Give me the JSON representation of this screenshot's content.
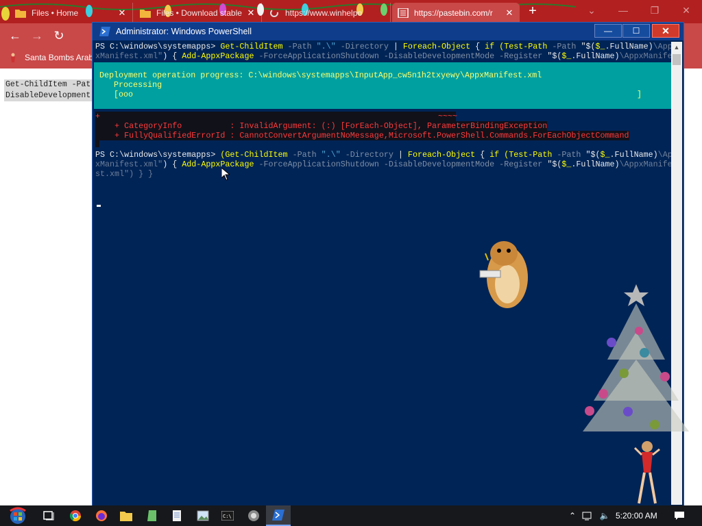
{
  "browser": {
    "tabs": [
      {
        "label": "Files • Home"
      },
      {
        "label": "Files • Download stable"
      },
      {
        "label": "https://www.winhelpo"
      },
      {
        "label": "https://pastebin.com/r"
      }
    ],
    "new_tab_symbol": "+",
    "bookmark": {
      "label": "Santa Bombs Arab"
    },
    "page_snippet": [
      "Get-ChildItem -Pat",
      "DisableDevelopment"
    ],
    "theme_color": "#c94848"
  },
  "powershell": {
    "title": "Administrator: Windows PowerShell",
    "controls": {
      "minimize": "—",
      "maximize": "☐",
      "close": "✕"
    },
    "console": {
      "prompt": "PS C:\\windows\\systemapps>",
      "cmd1_line1": {
        "a": "Get-ChildItem",
        "b": " -Path ",
        "c": "\".\\\"",
        "d": " -Directory ",
        "e": "|",
        "f": " Foreach-Object ",
        "g": "{ ",
        "h": "if",
        "i": " (Test-Path",
        "j": " -Path ",
        "k": "\"$(",
        "l": "$_",
        "m": ".FullName)",
        "n": "\\App"
      },
      "cmd1_line2": {
        "a": "xManifest.xml\"",
        "b": ") { ",
        "c": "Add-AppxPackage",
        "d": " -ForceApplicationShutdown -DisableDevelopmentMode -Register ",
        "e": "\"$(",
        "f": "$_",
        "g": ".FullName)",
        "h": "\\AppxManife"
      },
      "progress": {
        "line1": "Deployment operation progress: C:\\windows\\systemapps\\InputApp_cw5n1h2txyewy\\AppxManifest.xml",
        "line2": "Processing",
        "line3": "[ooo",
        "line3_end": "]"
      },
      "error": {
        "marker": "+",
        "tilde": "~~~~",
        "category_info": "+ CategoryInfo          : InvalidArgument: (:) [ForEach-Object], ParameterBindingException",
        "fq_error": "+ FullyQualifiedErrorId : CannotConvertArgumentNoMessage,Microsoft.PowerShell.Commands.ForEachObjectCommand"
      },
      "cmd2_line1": {
        "a": "(Get-ChildItem",
        "b": " -Path ",
        "c": "\".\\\"",
        "d": " -Directory ",
        "e": "|",
        "f": " Foreach-Object ",
        "g": "{ ",
        "h": "if",
        "i": " (Test-Path",
        "j": " -Path ",
        "k": "\"$(",
        "l": "$_",
        "m": ".FullName)",
        "n": "\\App"
      },
      "cmd2_line2": {
        "a": "xManifest.xml\"",
        "b": ") { ",
        "c": "Add-AppxPackage",
        "d": " -ForceApplicationShutdown -DisableDevelopmentMode -Register ",
        "e": "\"$(",
        "f": "$_",
        "g": ".FullName)",
        "h": "\\AppxManife"
      },
      "cmd2_line3": "st.xml\") } }"
    }
  },
  "taskbar": {
    "clock": "5:20:00 AM",
    "pinned": [
      "start-orb",
      "task-view",
      "chrome",
      "firefox",
      "file-explorer",
      "notepad-plus",
      "notepad",
      "image-viewer",
      "cmd",
      "steam-like",
      "powershell"
    ]
  }
}
